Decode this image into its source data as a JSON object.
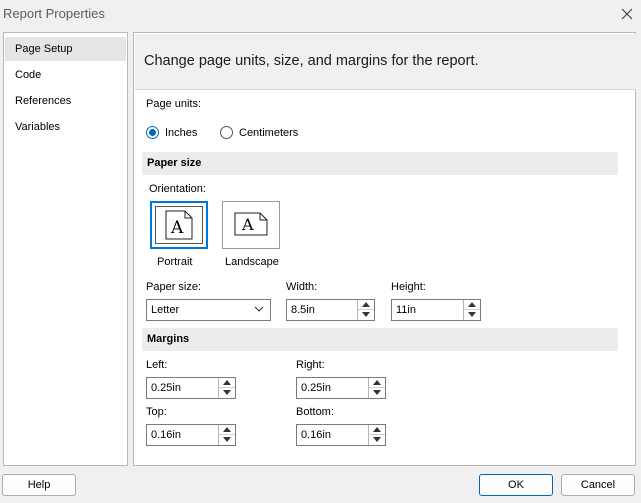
{
  "window": {
    "title": "Report Properties"
  },
  "sidebar": {
    "items": [
      {
        "label": "Page Setup"
      },
      {
        "label": "Code"
      },
      {
        "label": "References"
      },
      {
        "label": "Variables"
      }
    ]
  },
  "header": {
    "text": "Change page units, size, and margins for the report."
  },
  "page_units": {
    "label": "Page units:",
    "options": [
      {
        "label": "Inches",
        "checked": true
      },
      {
        "label": "Centimeters",
        "checked": false
      }
    ]
  },
  "paper_size_section": {
    "title": "Paper size",
    "orientation_label": "Orientation:",
    "portrait": {
      "label": "Portrait",
      "glyph": "A"
    },
    "landscape": {
      "label": "Landscape",
      "glyph": "A"
    },
    "paper_size_label": "Paper size:",
    "paper_size_value": "Letter",
    "width_label": "Width:",
    "width_value": "8.5in",
    "height_label": "Height:",
    "height_value": "11in"
  },
  "margins": {
    "title": "Margins",
    "left_label": "Left:",
    "left_value": "0.25in",
    "right_label": "Right:",
    "right_value": "0.25in",
    "top_label": "Top:",
    "top_value": "0.16in",
    "bottom_label": "Bottom:",
    "bottom_value": "0.16in"
  },
  "buttons": {
    "help": "Help",
    "ok": "OK",
    "cancel": "Cancel"
  },
  "colors": {
    "accent": "#0067c0",
    "section_bg": "#ececec",
    "header_bg": "#f0f0f0"
  }
}
